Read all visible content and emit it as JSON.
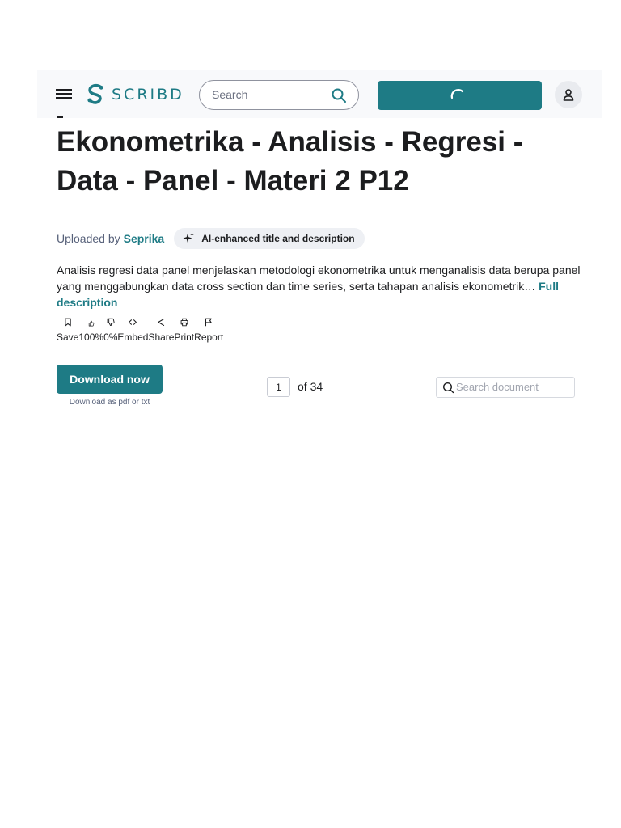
{
  "header": {
    "brand": "SCRIBD",
    "search_placeholder": "Search"
  },
  "document": {
    "title": "Ekonometrika - Analisis - Regresi - Data - Panel - Materi 2 P12",
    "uploaded_by_label": "Uploaded by",
    "uploader": "Seprika",
    "ai_badge": "AI-enhanced title and description",
    "description": "Analisis regresi data panel menjelaskan metodologi ekonometrika untuk menganalisis data berupa panel yang menggabungkan data cross section dan time series, serta tahapan analisis ekonometrik…",
    "full_description_link": "Full description"
  },
  "actions": [
    {
      "label": "Save",
      "icon": "bookmark-icon"
    },
    {
      "label": "100%",
      "icon": "thumbs-up-icon"
    },
    {
      "label": "0%",
      "icon": "thumbs-down-icon"
    },
    {
      "label": "Embed",
      "icon": "code-icon"
    },
    {
      "label": "Share",
      "icon": "share-icon"
    },
    {
      "label": "Print",
      "icon": "print-icon"
    },
    {
      "label": "Report",
      "icon": "flag-icon"
    }
  ],
  "download": {
    "button": "Download now",
    "subtext": "Download as pdf or txt"
  },
  "pager": {
    "current_page": "1",
    "total_label": "of 34"
  },
  "doc_search": {
    "placeholder": "Search document"
  },
  "colors": {
    "brand_teal": "#1e7b85",
    "text_dark": "#1c1d1f",
    "text_muted": "#57617a"
  }
}
